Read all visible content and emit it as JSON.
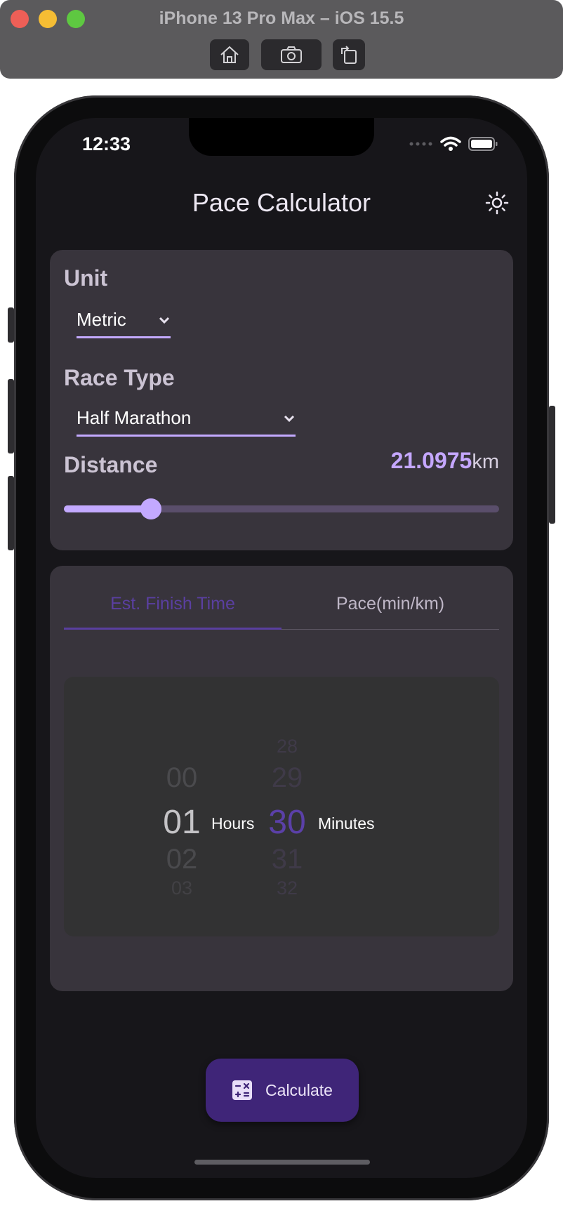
{
  "simulator": {
    "title": "iPhone 13 Pro Max – iOS 15.5",
    "buttons": [
      "home-icon",
      "screenshot-icon",
      "rotate-icon"
    ]
  },
  "status_bar": {
    "time": "12:33",
    "icons": [
      "cellular-icon",
      "wifi-icon",
      "battery-icon"
    ]
  },
  "app": {
    "title": "Pace Calculator",
    "settings_icon": "brightness-icon"
  },
  "settings_card": {
    "unit_label": "Unit",
    "unit_value": "Metric",
    "race_type_label": "Race Type",
    "race_type_value": "Half Marathon",
    "distance_label": "Distance",
    "distance_value": "21.0975",
    "distance_unit": "km",
    "slider_fraction": 0.2
  },
  "result_card": {
    "tabs": [
      {
        "label": "Est. Finish Time",
        "active": true
      },
      {
        "label": "Pace(min/km)",
        "active": false
      }
    ],
    "hours_picker": {
      "values": [
        "00",
        "01",
        "02",
        "03"
      ],
      "selected": "01",
      "unit": "Hours"
    },
    "minutes_picker": {
      "values": [
        "28",
        "29",
        "30",
        "31",
        "32"
      ],
      "selected": "30",
      "unit": "Minutes"
    }
  },
  "calculate_button": {
    "label": "Calculate",
    "icon": "calculator-icon"
  },
  "colors": {
    "accent": "#c3a9ff",
    "tab_active": "#5a3fa0",
    "button_bg": "#3f2578",
    "card_bg": "#38343c",
    "screen_bg": "#17161a"
  }
}
